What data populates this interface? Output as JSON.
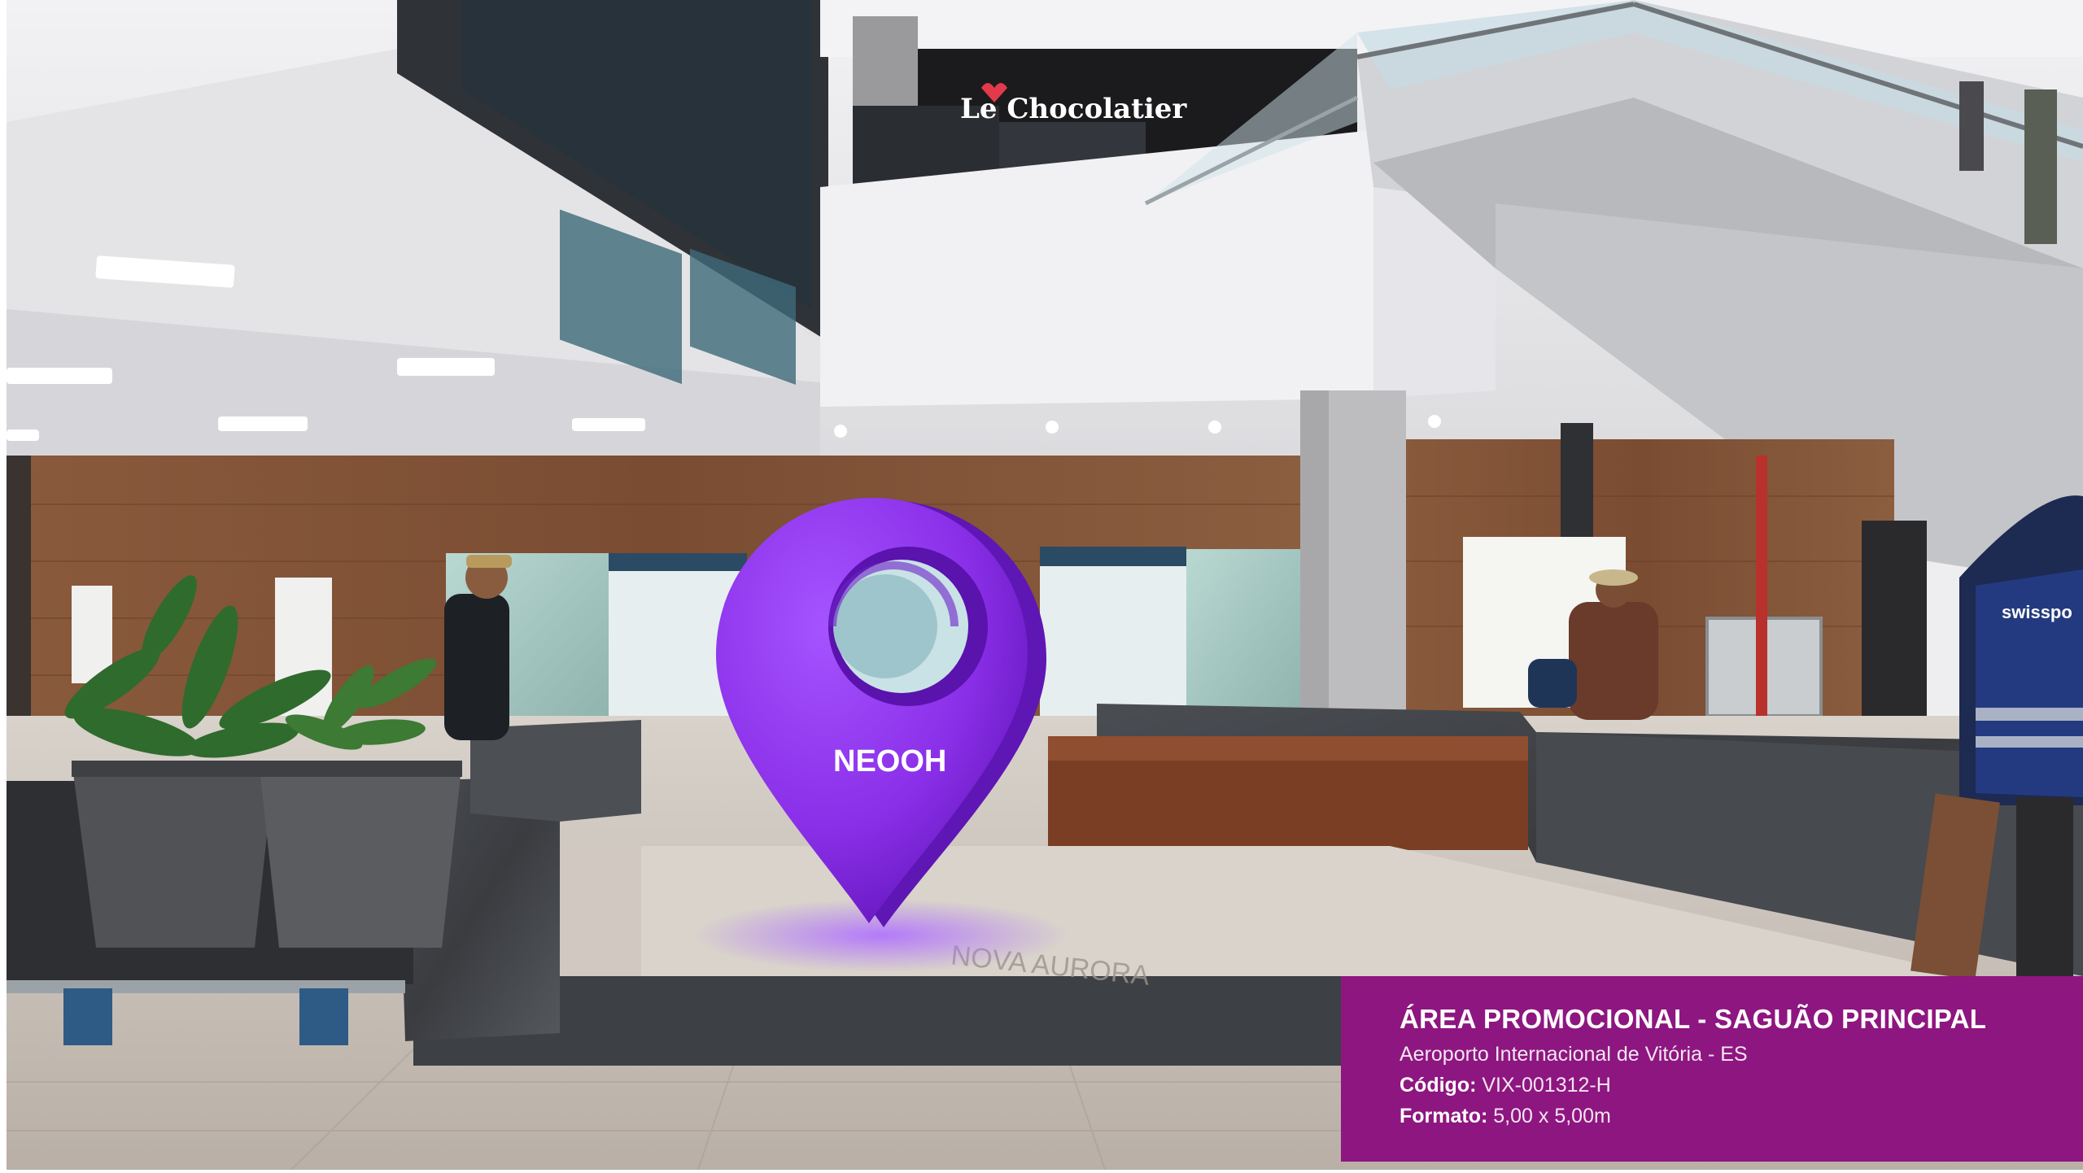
{
  "scene": {
    "store_sign": "Le Chocolatier",
    "pin_logo": "NEOOH",
    "vest_text": "swisspo",
    "floor_logo": "NOVA AURORA",
    "pin_color": "#8a2fe8",
    "icons": [
      "location-pin-icon"
    ]
  },
  "caption": {
    "title": "ÁREA PROMOCIONAL - SAGUÃO PRINCIPAL",
    "location": "Aeroporto Internacional de Vitória - ES",
    "code_label": "Código:",
    "code_value": "VIX-001312-H",
    "format_label": "Formato:",
    "format_value": "5,00 x 5,00m",
    "background": "#8e1680"
  }
}
